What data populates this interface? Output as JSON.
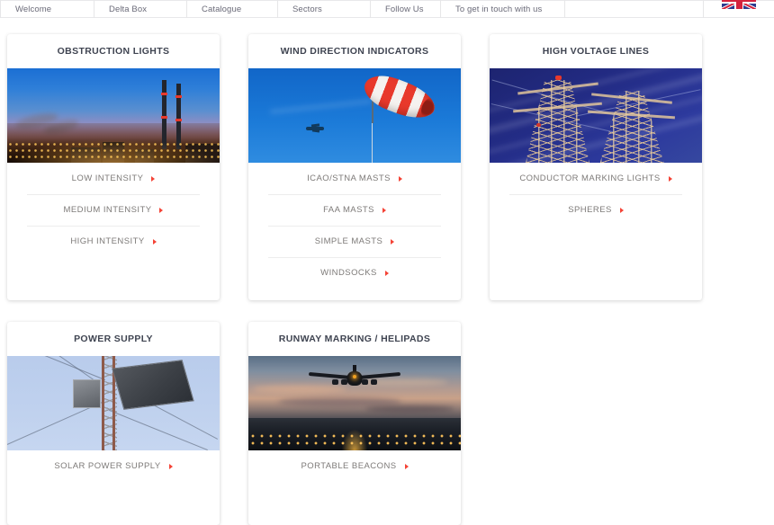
{
  "nav": {
    "items": [
      {
        "label": "Welcome",
        "name": "nav-item-welcome"
      },
      {
        "label": "Delta Box",
        "name": "nav-item-delta-box"
      },
      {
        "label": "Catalogue",
        "name": "nav-item-catalogue"
      },
      {
        "label": "Sectors",
        "name": "nav-item-sectors"
      },
      {
        "label": "Follow Us",
        "name": "nav-item-follow-us"
      },
      {
        "label": "To get in touch with us",
        "name": "nav-item-contact"
      }
    ],
    "flag_icon": "uk-flag-icon"
  },
  "colors": {
    "accent_red": "#f44336",
    "title_text": "#3f4451",
    "link_text": "#7d7a78",
    "nav_text": "#6a6a78",
    "divider": "#ededed",
    "page_background": "#ffffff"
  },
  "cards": [
    {
      "title": "OBSTRUCTION LIGHTS",
      "image": "industrial-plant-at-dusk-image",
      "art": "art-industrial",
      "links": [
        {
          "label": "LOW INTENSITY"
        },
        {
          "label": "MEDIUM INTENSITY"
        },
        {
          "label": "HIGH INTENSITY"
        }
      ]
    },
    {
      "title": "WIND DIRECTION INDICATORS",
      "image": "windsock-against-blue-sky-image",
      "art": "art-windsock",
      "links": [
        {
          "label": "ICAO/STNA MASTS"
        },
        {
          "label": "FAA MASTS"
        },
        {
          "label": "SIMPLE MASTS"
        },
        {
          "label": "WINDSOCKS"
        }
      ]
    },
    {
      "title": "HIGH VOLTAGE LINES",
      "image": "electricity-pylons-image",
      "art": "art-pylon",
      "links": [
        {
          "label": "CONDUCTOR MARKING LIGHTS"
        },
        {
          "label": "SPHERES"
        }
      ]
    },
    {
      "title": "POWER SUPPLY",
      "image": "solar-panel-mast-image",
      "art": "art-solar",
      "links": [
        {
          "label": "SOLAR POWER SUPPLY"
        }
      ]
    },
    {
      "title": "RUNWAY MARKING / HELIPADS",
      "image": "aircraft-landing-on-runway-at-dusk-image",
      "art": "art-runway",
      "links": [
        {
          "label": "PORTABLE BEACONS"
        }
      ]
    }
  ]
}
